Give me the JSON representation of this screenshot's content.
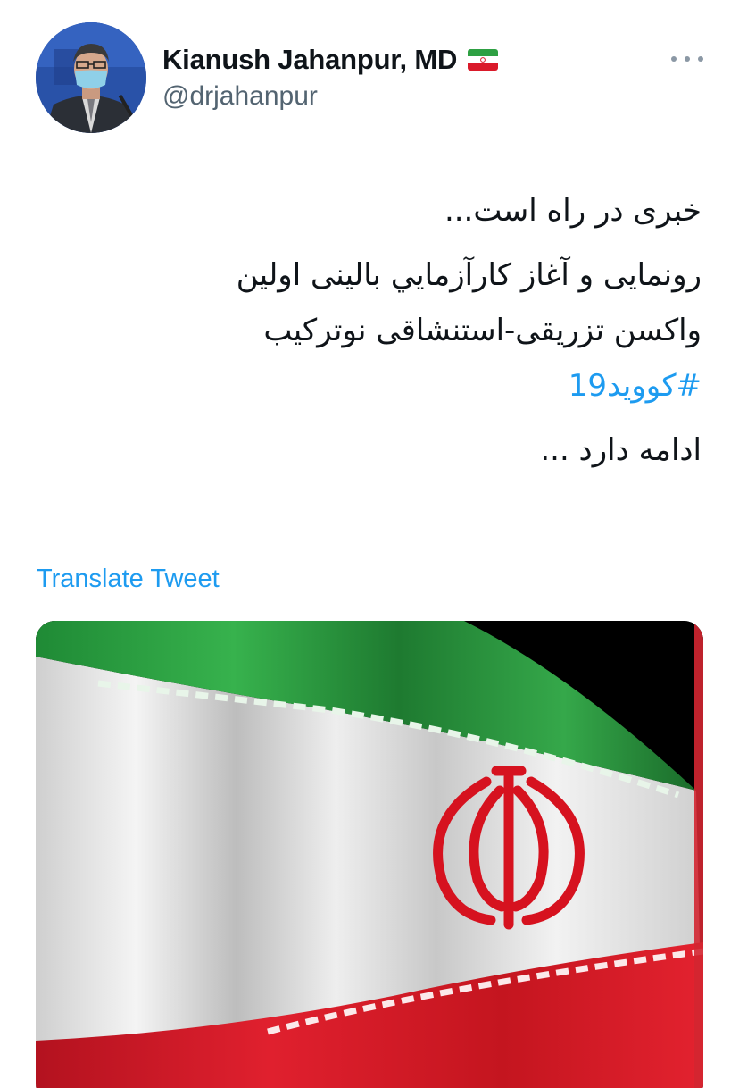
{
  "tweet": {
    "author": {
      "display_name": "Kianush Jahanpur, MD",
      "handle": "@drjahanpur",
      "flag_icon": "iran-flag-icon",
      "avatar_icon": "profile-photo"
    },
    "more_icon": "more-horizontal-icon",
    "text": {
      "line1": "خبری در راه است...",
      "line2": "رونمایی و آغاز کارآزمایي بالینی اولین",
      "line3": "واکسن تزریقی-استنشاقی نوترکیب",
      "hashtag": "#کووید19",
      "line5": "ادامه دارد ..."
    },
    "translate_label": "Translate Tweet",
    "media": {
      "description_icon": "iran-flag-image"
    },
    "colors": {
      "link": "#1d9bf0",
      "secondary_text": "#536471",
      "flag_green": "#2ea043",
      "flag_red": "#da1a2a"
    }
  }
}
